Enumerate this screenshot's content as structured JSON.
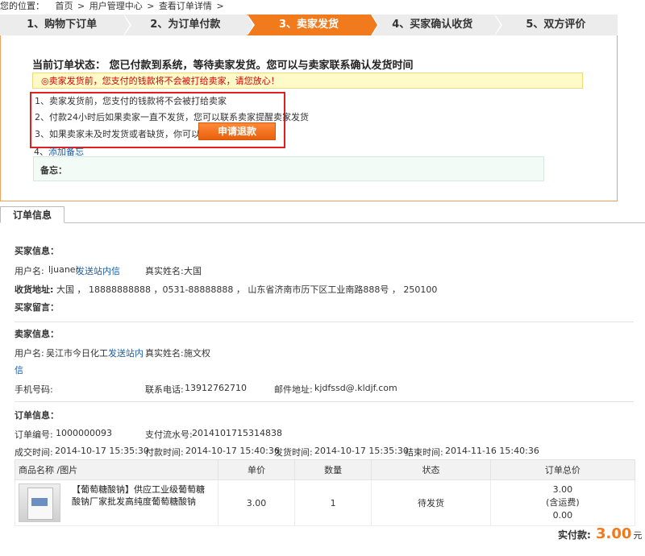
{
  "breadcrumb": {
    "prefix": "您的位置：",
    "items": [
      "首页",
      ">",
      "用户管理中心",
      ">",
      "查看订单详情",
      ">"
    ]
  },
  "steps": [
    "1、购物下订单",
    "2、为订单付款",
    "3、卖家发货",
    "4、买家确认收货",
    "5、双方评价"
  ],
  "status": {
    "title": "当前订单状态： 您已付款到系统，等待卖家发货。您可以与卖家联系确认发货时间",
    "notice": "◎卖家发货前，您支付的钱款将不会被打给卖家，请您放心！",
    "tips": [
      "1、卖家发货前，您支付的钱款将不会被打给卖家",
      "2、付款24小时后如果卖家一直不发货，您可以联系卖家提醒卖家发货",
      "3、如果卖家未及时发货或者缺货，你可以点此"
    ],
    "refund_button": "申请退款",
    "add_note_prefix": "4、",
    "add_note_link": "添加备忘",
    "memo_label": "备忘："
  },
  "order_tab": "订单信息",
  "buyer": {
    "section_title": "买家信息：",
    "username_label": "用户名:",
    "username": "ljuanei",
    "send_msg": "发送站内信",
    "realname_label": "真实姓名:",
    "realname": "大国",
    "address_label": "收货地址:",
    "address": "大国 ， 18888888888 ，0531-88888888 ， 山东省济南市历下区工业南路888号 ， 250100",
    "message_label": "买家留言："
  },
  "seller": {
    "section_title": "卖家信息：",
    "username_label": "用户名:",
    "username": "吴江市今日化工",
    "send_msg_1": "发送站内",
    "send_msg_2": "信",
    "realname_label": "真实姓名:",
    "realname": "施文权",
    "mobile_label": "手机号码:",
    "phone_label": "联系电话:",
    "phone": "13912762710",
    "email_label": "邮件地址:",
    "email": "kjdfssd@.kldjf.com"
  },
  "order": {
    "section_title": "订单信息：",
    "number_label": "订单编号:",
    "number": "1000000093",
    "serial_label": "支付流水号:",
    "serial": "2014101715314838",
    "created_label": "成交时间:",
    "created": "2014-10-17 15:35:30",
    "paid_label": "付款时间:",
    "paid": "2014-10-17 15:40:36",
    "shipped_label": "发货时间:",
    "shipped": "2014-10-17 15:35:30",
    "closed_label": "结束时间:",
    "closed": "2014-11-16 15:40:36"
  },
  "goods": {
    "headers": [
      "商品名称 /图片",
      "单价",
      "数量",
      "状态",
      "订单总价"
    ],
    "item": {
      "name": "【葡萄糖酸钠】供应工业级葡萄糖酸钠厂家批发高纯度葡萄糖酸钠",
      "price": "3.00",
      "qty": "1",
      "status": "待发货",
      "total": "3.00",
      "shipping_note": "(含运费)",
      "shipping": "0.00"
    }
  },
  "payment": {
    "label": "实付款:",
    "amount": "3.00",
    "unit": "元"
  },
  "colors": {
    "accent": "#f07a1c",
    "link": "#1a5ca8",
    "alert": "#d40000"
  }
}
